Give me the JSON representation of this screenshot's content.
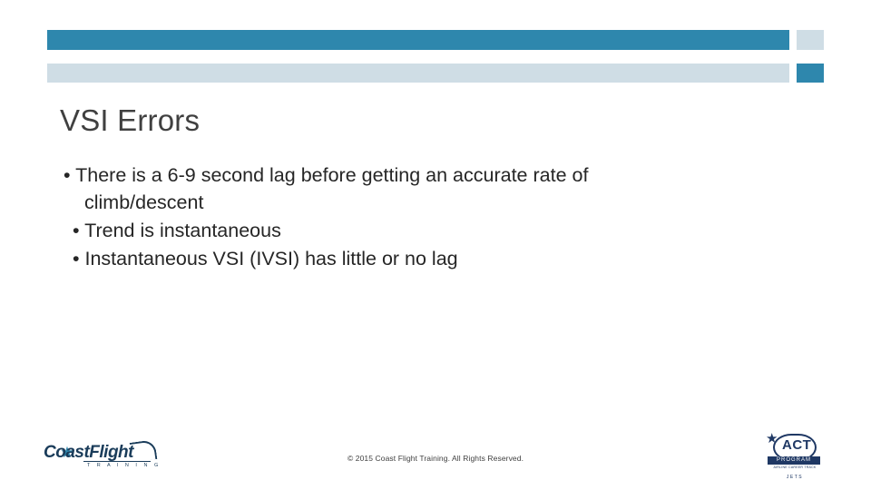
{
  "slide": {
    "title": "VSI Errors",
    "bullets": [
      "There is a 6-9 second lag before getting an accurate rate of climb/descent",
      "Trend is instantaneous",
      "Instantaneous VSI (IVSI) has little or no lag"
    ],
    "bullet_marker": "•",
    "bullet_line1_a": "• There is a 6-9 second lag before getting an accurate rate of",
    "bullet_line1_b": "climb/descent",
    "bullet_line2": "• Trend is instantaneous",
    "bullet_line3": "• Instantaneous VSI (IVSI) has little or no lag",
    "footer": "© 2015 Coast Flight Training. All Rights Reserved.",
    "colors": {
      "accent_blue": "#2e87ad",
      "accent_light": "#cfdde5",
      "title_text": "#404040",
      "body_text": "#262626",
      "logo_navy": "#1f3864"
    }
  },
  "logo_left": {
    "name": "CoastFlight",
    "wordmark": "CoastFlight",
    "subtitle": "T R A I N I N G",
    "star_glyph": "★"
  },
  "logo_right": {
    "acronym": "ACT",
    "star_glyph": "★",
    "band": "PROGRAM",
    "tagline": "AIRLINE CAREER TRACK",
    "subtitle": "JETS"
  }
}
